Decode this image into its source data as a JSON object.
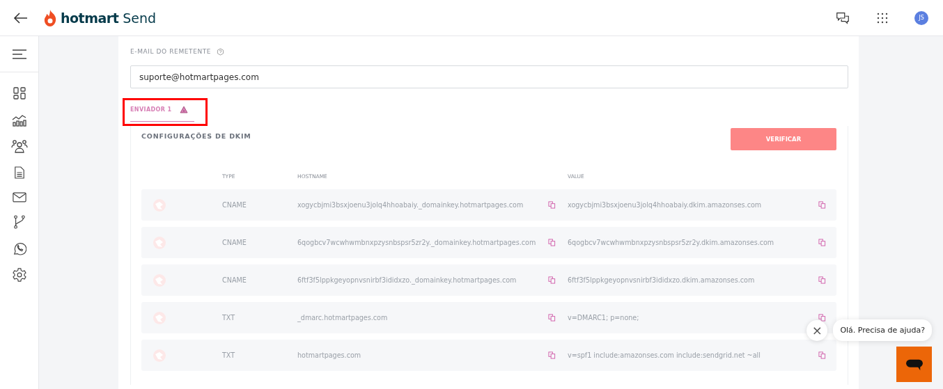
{
  "header": {
    "brand": "hotmart",
    "product": "Send",
    "avatar": "JS"
  },
  "sidebar": {
    "items": [
      {
        "kind": "dashboard"
      },
      {
        "kind": "chart"
      },
      {
        "kind": "people"
      },
      {
        "kind": "document"
      },
      {
        "kind": "mail"
      },
      {
        "kind": "flow"
      },
      {
        "kind": "whatsapp"
      },
      {
        "kind": "settings"
      }
    ]
  },
  "sender_email": {
    "label": "E-MAIL DO REMETENTE",
    "value": "suporte@hotmartpages.com"
  },
  "tabs": [
    {
      "label": "ENVIADOR 1",
      "selected": true,
      "warning": true
    }
  ],
  "dkim": {
    "title": "CONFIGURAÇÕES DE DKIM",
    "button": "VERIFICAR",
    "columns": [
      "TYPE",
      "HOSTNAME",
      "VALUE"
    ],
    "rows": [
      {
        "type": "CNAME",
        "hostname": "xogycbjmi3bsxjoenu3jolq4hhoabaiy._domainkey.hotmartpages.com",
        "value": "xogycbjmi3bsxjoenu3jolq4hhoabaiy.dkim.amazonses.com"
      },
      {
        "type": "CNAME",
        "hostname": "6qogbcv7wcwhwmbnxpzysnbspsr5zr2y._domainkey.hotmartpages.com",
        "value": "6qogbcv7wcwhwmbnxpzysnbspsr5zr2y.dkim.amazonses.com"
      },
      {
        "type": "CNAME",
        "hostname": "6ftf3f5lppkgeyopnvsnirbf3ididxzo._domainkey.hotmartpages.com",
        "value": "6ftf3f5lppkgeyopnvsnirbf3ididxzo.dkim.amazonses.com"
      },
      {
        "type": "TXT",
        "hostname": "_dmarc.hotmartpages.com",
        "value": "v=DMARC1; p=none;"
      },
      {
        "type": "TXT",
        "hostname": "hotmartpages.com",
        "value": "v=spf1 include:amazonses.com include:sendgrid.net ~all"
      }
    ]
  },
  "chat": {
    "message": "Olá. Precisa de ajuda?",
    "close": "×"
  }
}
